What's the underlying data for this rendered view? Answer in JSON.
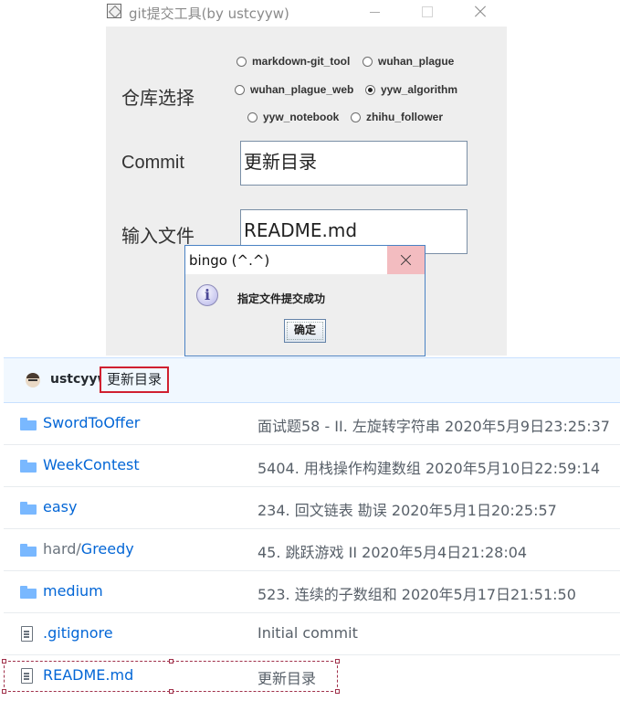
{
  "window": {
    "title": "git提交工具(by ustcyyw)",
    "repo_label": "仓库选择",
    "commit_label": "Commit",
    "file_label": "输入文件",
    "repos": [
      {
        "name": "markdown-git_tool",
        "selected": false
      },
      {
        "name": "wuhan_plague",
        "selected": false
      },
      {
        "name": "wuhan_plague_web",
        "selected": false
      },
      {
        "name": "yyw_algorithm",
        "selected": true
      },
      {
        "name": "yyw_notebook",
        "selected": false
      },
      {
        "name": "zhihu_follower",
        "selected": false
      }
    ],
    "commit_value": "更新目录",
    "file_value": "README.md"
  },
  "dialog": {
    "title": "bingo (^.^)",
    "message": "指定文件提交成功",
    "ok_label": "确定",
    "icon": "information-icon"
  },
  "repo": {
    "commit_user": "ustcyyw",
    "commit_message": "更新目录",
    "files": [
      {
        "type": "folder",
        "name": "SwordToOffer",
        "message": "面试题58 - II. 左旋转字符串 2020年5月9日23:25:37"
      },
      {
        "type": "folder",
        "name": "WeekContest",
        "message": "5404. 用栈操作构建数组 2020年5月10日22:59:14"
      },
      {
        "type": "folder",
        "name": "easy",
        "message": "234. 回文链表 勘误 2020年5月1日20:25:57"
      },
      {
        "type": "folder",
        "name_prefix": "hard/",
        "name": "Greedy",
        "message": "45. 跳跃游戏 II 2020年5月4日21:28:04"
      },
      {
        "type": "folder",
        "name": "medium",
        "message": "523. 连续的子数组和 2020年5月17日21:51:50"
      },
      {
        "type": "file",
        "name": ".gitignore",
        "message": "Initial commit"
      },
      {
        "type": "file",
        "name": "README.md",
        "message": "更新目录"
      }
    ]
  }
}
